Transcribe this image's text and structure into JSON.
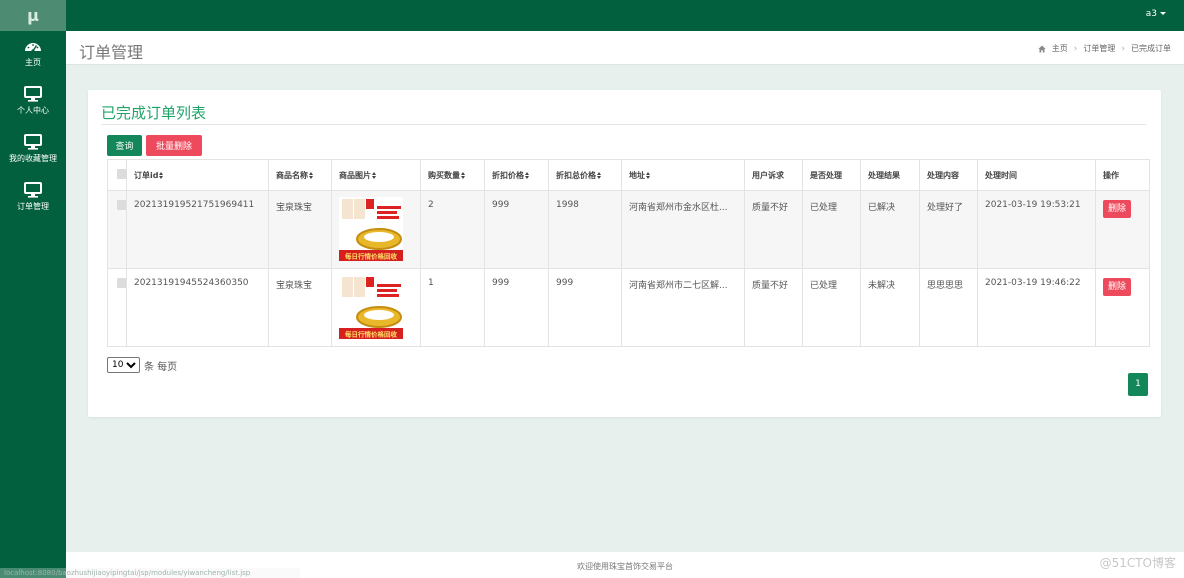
{
  "app": {
    "logo": "µ",
    "user": "a3"
  },
  "sidebar": {
    "items": [
      {
        "label": "主页",
        "icon": "dashboard-icon"
      },
      {
        "label": "个人中心",
        "icon": "monitor-icon"
      },
      {
        "label": "我的收藏管理",
        "icon": "monitor-icon"
      },
      {
        "label": "订单管理",
        "icon": "monitor-icon"
      }
    ]
  },
  "header": {
    "title": "订单管理",
    "breadcrumb": [
      "主页",
      "订单管理",
      "已完成订单"
    ]
  },
  "panel": {
    "title": "已完成订单列表",
    "query_label": "查询",
    "batch_delete_label": "批量删除"
  },
  "table": {
    "columns": [
      "订单id",
      "商品名称",
      "商品图片",
      "购买数量",
      "折扣价格",
      "折扣总价格",
      "地址",
      "用户诉求",
      "是否处理",
      "处理结果",
      "处理内容",
      "处理时间",
      "操作"
    ],
    "rows": [
      {
        "order_id": "202131919521751969411",
        "product": "宝泉珠宝",
        "image_caption": "每日行情价格回收",
        "qty": "2",
        "price": "999",
        "total": "1998",
        "address": "河南省郑州市金水区杜...",
        "request": "质量不好",
        "handled": "已处理",
        "result": "已解决",
        "content": "处理好了",
        "time": "2021-03-19 19:53:21",
        "action": "删除"
      },
      {
        "order_id": "20213191945524360350",
        "product": "宝泉珠宝",
        "image_caption": "每日行情价格回收",
        "qty": "1",
        "price": "999",
        "total": "999",
        "address": "河南省郑州市二七区解...",
        "request": "质量不好",
        "handled": "已处理",
        "result": "未解决",
        "content": "思思思思",
        "time": "2021-03-19 19:46:22",
        "action": "删除"
      }
    ]
  },
  "pagination": {
    "page_size": "10",
    "page_size_suffix": "条 每页",
    "current_page": "1"
  },
  "footer": {
    "text": "欢迎使用珠宝首饰交易平台"
  },
  "watermark": "@51CTO博客",
  "status_url": "localhost:8080/baozhushijiaoyipingtai/jsp/modules/yiwancheng/list.jsp",
  "colors": {
    "primary": "#03603f",
    "accent": "#13865a",
    "danger": "#ee4a5d",
    "title_green": "#20a46a"
  }
}
